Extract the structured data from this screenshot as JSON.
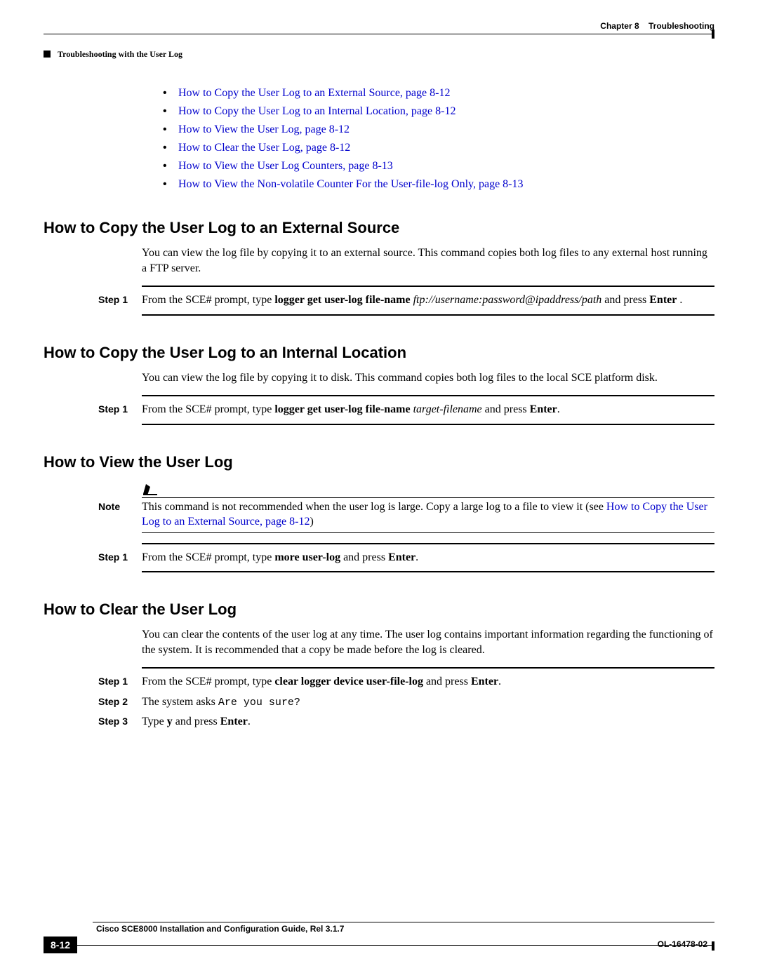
{
  "header": {
    "chapter_label": "Chapter 8",
    "chapter_title": "Troubleshooting",
    "section": "Troubleshooting with the User Log"
  },
  "toc": [
    "How to Copy the User Log to an External Source, page 8-12",
    "How to Copy the User Log to an Internal Location, page 8-12",
    "How to View the User Log, page 8-12",
    "How to Clear the User Log, page 8-12",
    "How to View the User Log Counters, page 8-13",
    "How to View the Non-volatile Counter For the User-file-log Only, page 8-13"
  ],
  "sec1": {
    "title": "How to Copy the User Log to an External Source",
    "intro": "You can view the log file by copying it to an external source. This command copies both log files to any external host running a FTP server.",
    "step_label": "Step 1",
    "step_pre": "From the SCE# prompt, type ",
    "step_cmd": "logger get user-log file-name",
    "step_arg": " ftp://username:password@ipaddress/path",
    "step_post1": "and press ",
    "step_post2": "Enter",
    "step_post3": " ."
  },
  "sec2": {
    "title": "How to Copy the User Log to an Internal Location",
    "intro": "You can view the log file by copying it to disk. This command copies both log files to the local SCE platform disk.",
    "step_label": "Step 1",
    "step_pre": "From the SCE# prompt, type ",
    "step_cmd": "logger get user-log file-name",
    "step_arg": " target-filename",
    "step_mid": " and press ",
    "step_enter": "Enter",
    "step_end": "."
  },
  "sec3": {
    "title": "How to View the User Log",
    "note_label": "Note",
    "note_text_a": "This command is not recommended when the user log is large. Copy a large log to a file to view it (see ",
    "note_link": "How to Copy the User Log to an External Source, page 8-12",
    "note_text_b": ")",
    "step_label": "Step 1",
    "step_pre": "From the SCE# prompt, type ",
    "step_cmd": "more user-log",
    "step_mid": " and press ",
    "step_enter": "Enter",
    "step_end": "."
  },
  "sec4": {
    "title": "How to Clear the User Log",
    "intro": "You can clear the contents of the user log at any time. The user log contains important information regarding the functioning of the system. It is recommended that a copy be made before the log is cleared.",
    "steps": {
      "s1_label": "Step 1",
      "s1_pre": "From the SCE# prompt, type ",
      "s1_cmd": "clear logger device user-file-log",
      "s1_mid": " and press ",
      "s1_enter": "Enter",
      "s1_end": ".",
      "s2_label": "Step 2",
      "s2_pre": "The system asks ",
      "s2_mono": "Are you sure?",
      "s3_label": "Step 3",
      "s3_pre": "Type ",
      "s3_cmd": "y",
      "s3_mid": " and press ",
      "s3_enter": "Enter",
      "s3_end": "."
    }
  },
  "footer": {
    "book": "Cisco SCE8000 Installation and Configuration Guide, Rel 3.1.7",
    "page": "8-12",
    "doc": "OL-16478-02"
  }
}
